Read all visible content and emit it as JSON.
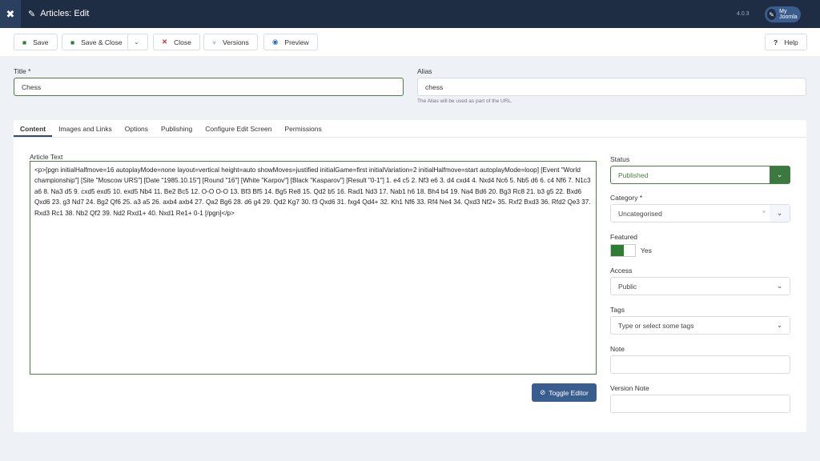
{
  "header": {
    "title": "Articles: Edit",
    "version": "4.0.3",
    "my_joomla": "My Joomla"
  },
  "toolbar": {
    "save": "Save",
    "save_close": "Save & Close",
    "close": "Close",
    "versions": "Versions",
    "preview": "Preview",
    "help": "Help"
  },
  "form": {
    "title_label": "Title *",
    "title_value": "Chess",
    "alias_label": "Alias",
    "alias_value": "chess",
    "alias_help": "The Alias will be used as part of the URL."
  },
  "tabs": [
    "Content",
    "Images and Links",
    "Options",
    "Publishing",
    "Configure Edit Screen",
    "Permissions"
  ],
  "content": {
    "article_label": "Article Text",
    "article_text": "<p>[pgn initialHalfmove=16 autoplayMode=none layout=vertical height=auto showMoves=justified initialGame=first initialVariation=2 initialHalfmove=start autoplayMode=loop] [Event \"World championship\"] [Site \"Moscow URS\"] [Date \"1985.10.15\"] [Round \"16\"] [White \"Karpov\"] [Black \"Kasparov\"] [Result \"0-1\"] 1. e4 c5 2. Nf3 e6 3. d4 cxd4 4. Nxd4 Nc6 5. Nb5 d6 6. c4 Nf6 7. N1c3 a6 8. Na3 d5 9. cxd5 exd5 10. exd5 Nb4 11. Be2 Bc5 12. O-O O-O 13. Bf3 Bf5 14. Bg5 Re8 15. Qd2 b5 16. Rad1 Nd3 17. Nab1 h6 18. Bh4 b4 19. Na4 Bd6 20. Bg3 Rc8 21. b3 g5 22. Bxd6 Qxd6 23. g3 Nd7 24. Bg2 Qf6 25. a3 a5 26. axb4 axb4 27. Qa2 Bg6 28. d6 g4 29. Qd2 Kg7 30. f3 Qxd6 31. fxg4 Qd4+ 32. Kh1 Nf6 33. Rf4 Ne4 34. Qxd3 Nf2+ 35. Rxf2 Bxd3 36. Rfd2 Qe3 37. Rxd3 Rc1 38. Nb2 Qf2 39. Nd2 Rxd1+ 40. Nxd1 Re1+ 0-1 [/pgn]</p>",
    "toggle_editor": "Toggle Editor"
  },
  "sidebar": {
    "status_label": "Status",
    "status_value": "Published",
    "category_label": "Category *",
    "category_value": "Uncategorised",
    "featured_label": "Featured",
    "featured_value": "Yes",
    "access_label": "Access",
    "access_value": "Public",
    "tags_label": "Tags",
    "tags_placeholder": "Type or select some tags",
    "note_label": "Note",
    "version_note_label": "Version Note"
  }
}
